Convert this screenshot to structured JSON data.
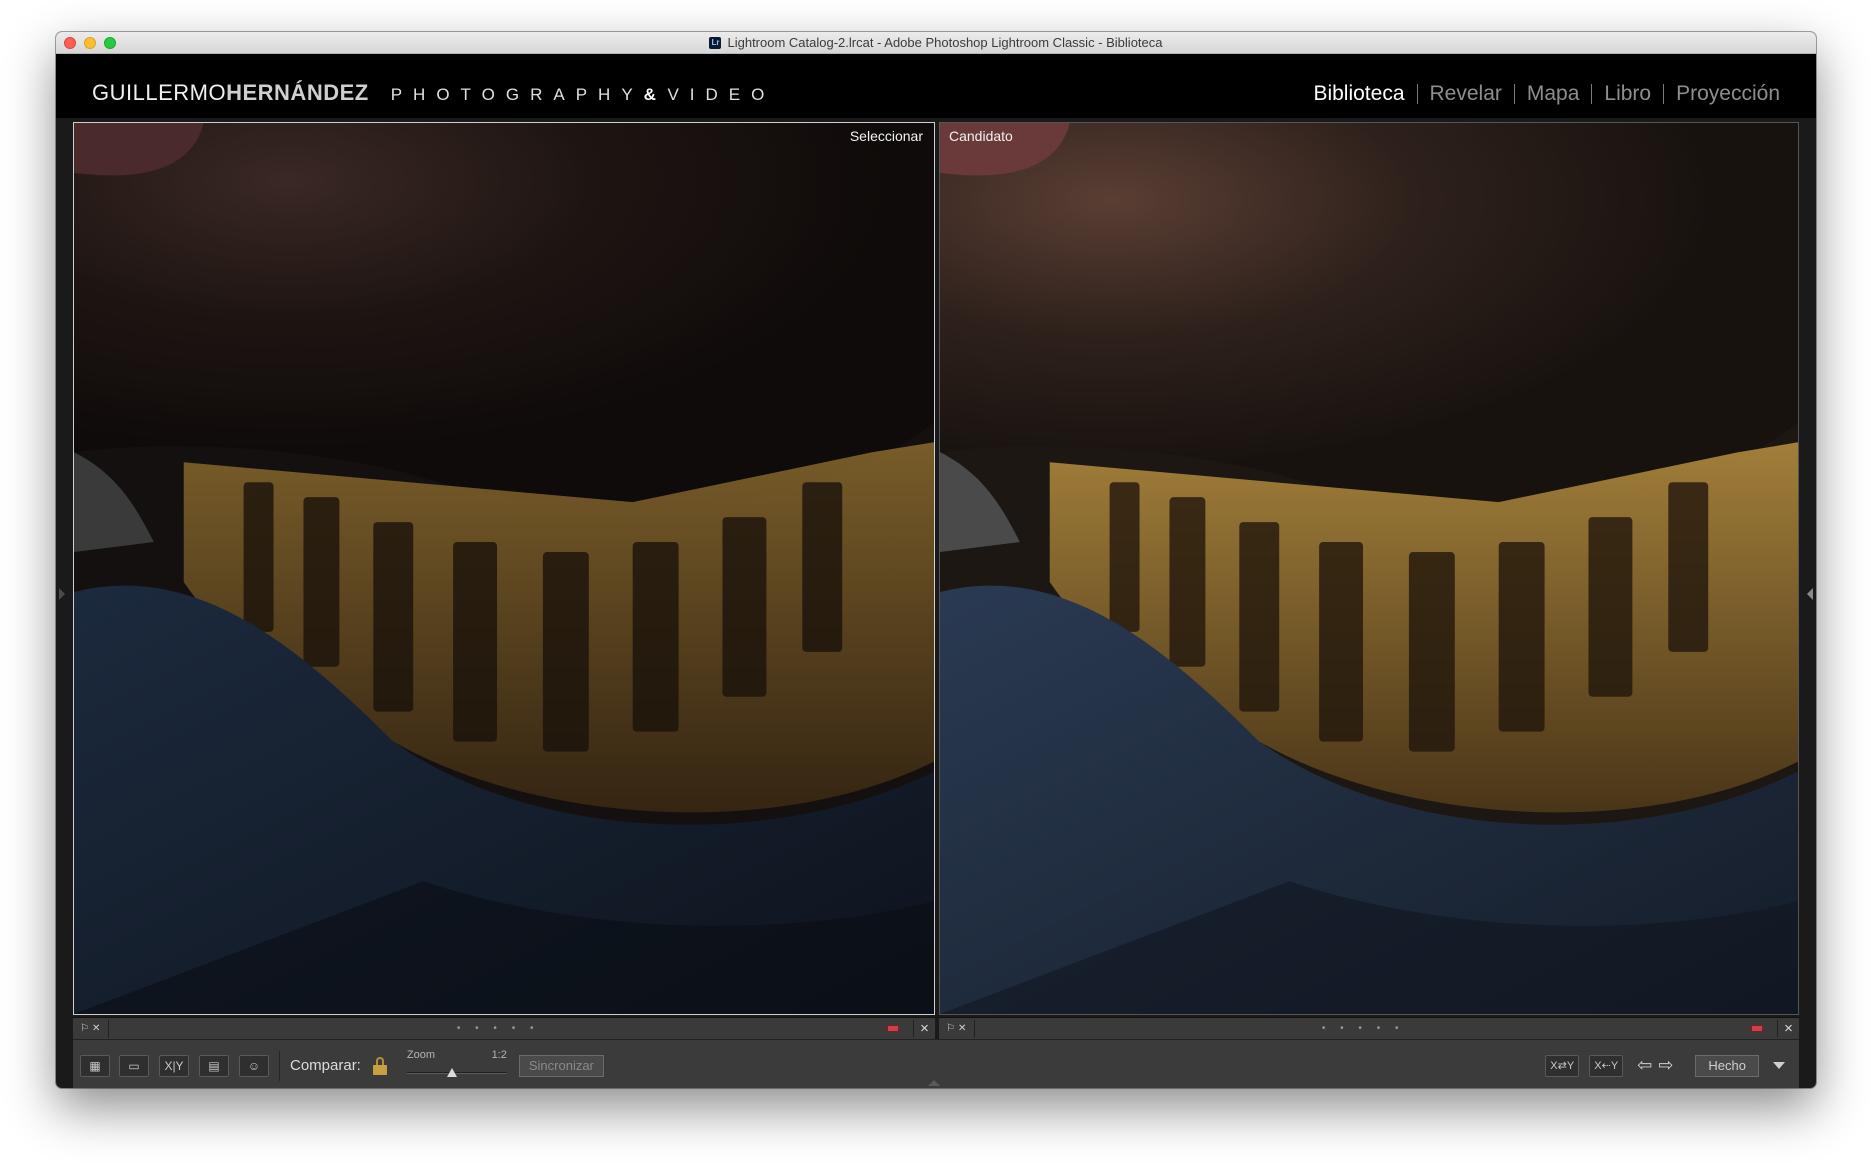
{
  "window": {
    "title": "Lightroom Catalog-2.lrcat - Adobe Photoshop Lightroom Classic - Biblioteca",
    "app_icon_letter": "Lr"
  },
  "identity": {
    "part1": "GUILLERMO",
    "part2": "HERNÁNDEZ",
    "part3": "PHOTOGRAPHY",
    "amp": "&",
    "part4": "VIDEO"
  },
  "modules": [
    {
      "label": "Biblioteca",
      "active": true
    },
    {
      "label": "Revelar",
      "active": false
    },
    {
      "label": "Mapa",
      "active": false
    },
    {
      "label": "Libro",
      "active": false
    },
    {
      "label": "Proyección",
      "active": false
    }
  ],
  "panes": {
    "left_label": "Seleccionar",
    "right_label": "Candidato",
    "dots": "• • • • •"
  },
  "toolbar": {
    "compare_label": "Comparar:",
    "zoom_label": "Zoom",
    "zoom_value": "1:2",
    "zoom_fraction": 0.45,
    "sync_label": "Sincronizar",
    "done_label": "Hecho",
    "xy_label": "X|Y",
    "swap_label": "X⇄Y",
    "makemain_label": "X⇠Y"
  },
  "icons": {
    "flag": "flag-icon",
    "reject": "reject-icon",
    "lock": "lock-icon",
    "prev": "left-arrow-icon",
    "next": "right-arrow-icon"
  },
  "colors": {
    "color_label_red": "#c9414a",
    "lock_gold": "#c8a040",
    "active_module": "#ffffff",
    "inactive_module": "#8e8e8e"
  }
}
